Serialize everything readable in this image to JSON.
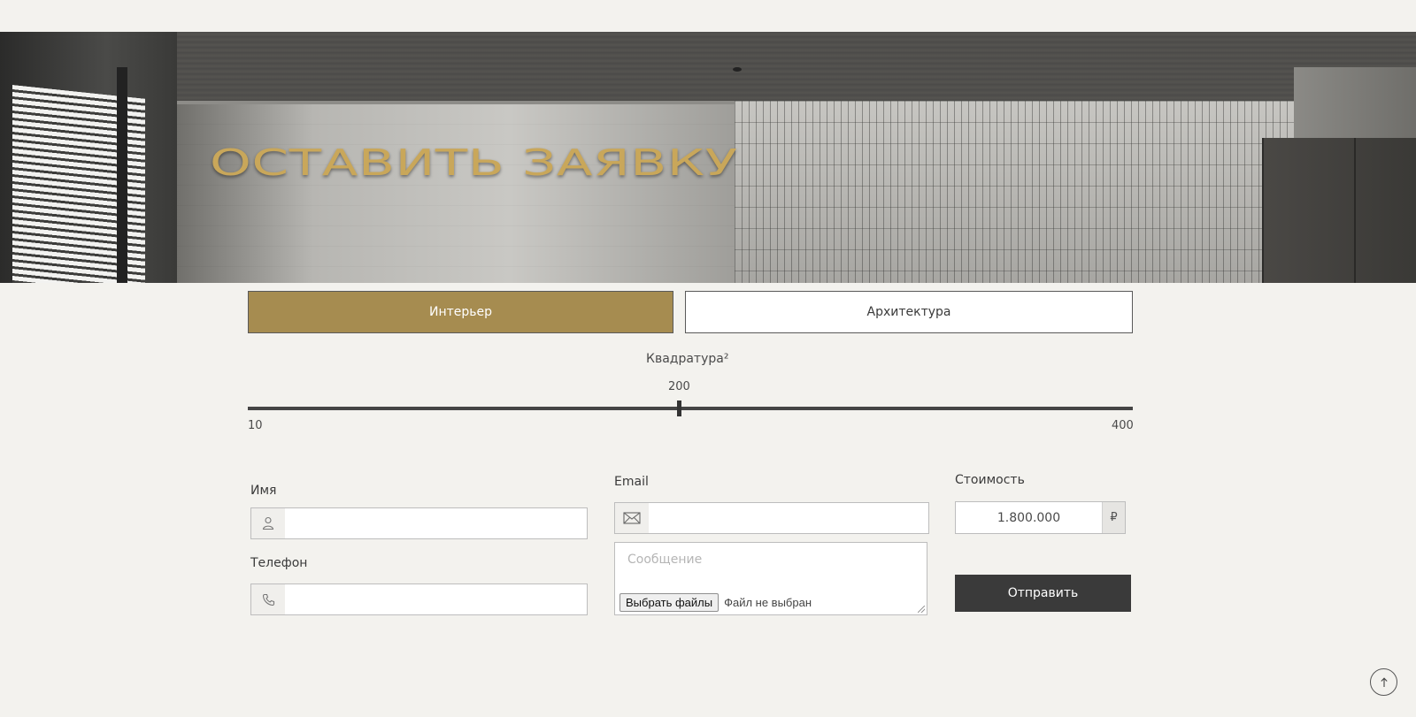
{
  "hero": {
    "title": "ОСТАВИТЬ ЗАЯВКУ"
  },
  "project_types": {
    "options": [
      "Интерьер",
      "Архитектура"
    ],
    "selected": "Интерьер"
  },
  "area_slider": {
    "label": "Квадратура²",
    "value": 200,
    "min": 10,
    "max": 400
  },
  "form": {
    "name_label": "Имя",
    "name_value": "",
    "phone_label": "Телефон",
    "phone_value": "",
    "email_label": "Email",
    "email_value": "",
    "message_placeholder": "Сообщение",
    "file_button_label": "Выбрать файлы",
    "file_status": "Файл не выбран",
    "cost_label": "Стоимость",
    "cost_value": "1.800.000",
    "currency": "₽",
    "submit_label": "Отправить"
  },
  "colors": {
    "accent": "#a68c50",
    "title_gold": "#c9a75a",
    "dark_button": "#3a3a3a",
    "background": "#f3f2ee"
  },
  "icons": {
    "name_field": "user-icon",
    "phone_field": "phone-icon",
    "email_field": "envelope-icon",
    "scroll_top": "arrow-up-icon"
  }
}
